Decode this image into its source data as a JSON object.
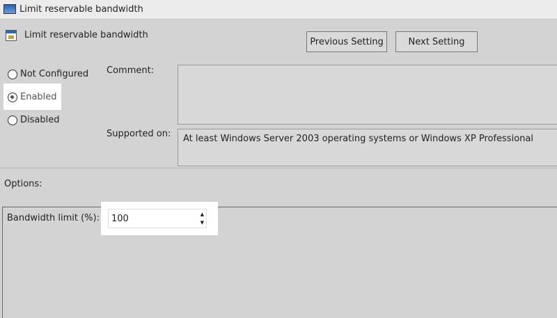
{
  "window": {
    "title": "Limit reservable bandwidth"
  },
  "header": {
    "setting_title": "Limit reservable bandwidth",
    "prev_label": "Previous Setting",
    "next_label": "Next Setting"
  },
  "state": {
    "options": [
      {
        "label": "Not Configured",
        "selected": false
      },
      {
        "label": "Enabled",
        "selected": true
      },
      {
        "label": "Disabled",
        "selected": false
      }
    ]
  },
  "comment": {
    "label": "Comment:",
    "value": ""
  },
  "supported": {
    "label": "Supported on:",
    "value": "At least Windows Server 2003 operating systems or Windows XP Professional"
  },
  "options": {
    "label": "Options:",
    "bandwidth_label": "Bandwidth limit (%):",
    "bandwidth_value": "100"
  }
}
